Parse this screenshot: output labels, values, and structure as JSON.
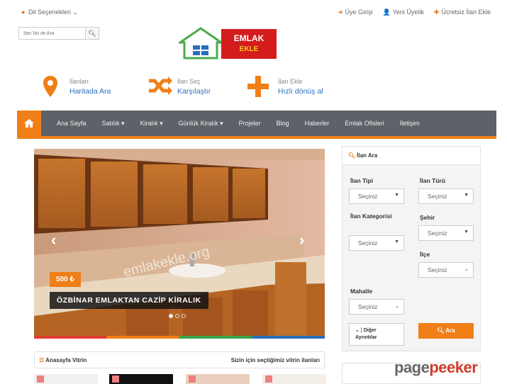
{
  "topbar": {
    "language_label": "Dil Seçenekleri",
    "login_label": "Üye Girişi",
    "register_label": "Yeni Üyelik",
    "free_listing_label": "Ücretsiz İlan Ekle"
  },
  "search": {
    "placeholder": "İlan No ile Ara",
    "button_icon": "search-icon"
  },
  "logo": {
    "line1": "EMLAK",
    "line2": "EKLE"
  },
  "features": [
    {
      "icon": "map-pin-icon",
      "line1": "İlanları",
      "line2": "Haritada Ara"
    },
    {
      "icon": "shuffle-icon",
      "line1": "İlan Seç",
      "line2": "Karşılaştır"
    },
    {
      "icon": "plus-icon",
      "line1": "İlan Ekle",
      "line2": "Hızlı dönüş al"
    }
  ],
  "nav": {
    "items": [
      "Ana Sayfa",
      "Satılık ▾",
      "Kiralık ▾",
      "Günlük Kiralık ▾",
      "Projeler",
      "Blog",
      "Haberler",
      "Emlak Ofisleri",
      "İletişim"
    ]
  },
  "slider": {
    "price": "500 ₺",
    "caption": "ÖZBİNAR EMLAKTAN CAZİP KİRALIK",
    "watermark": "emlakekle.org",
    "prev_icon": "chevron-left-icon",
    "next_icon": "chevron-right-icon"
  },
  "search_panel": {
    "title": "İlan Ara",
    "listing_type_label": "İlan Tipi",
    "listing_type_value": "Seçiniz",
    "listing_kind_label": "İlan Türü",
    "listing_kind_value": "Seçiniz",
    "category_label": "İlan Kategorisi",
    "category_value": "Seçiniz",
    "city_label": "Şehir",
    "city_value": "Seçiniz",
    "district_label": "İlçe",
    "district_value": "Seçiniz",
    "neighborhood_label": "Mahalle",
    "neighborhood_value": "Seçiniz",
    "other_line1": "Diğer",
    "other_line2": "Ayrıntılar",
    "search_button": "Ara"
  },
  "vitrin": {
    "title": "Anasayfa Vitrin",
    "subtitle": "Sizin için seçtiğimiz vitrin ilanları"
  },
  "watermark": {
    "part1": "page",
    "part2": "peeker"
  },
  "colors": {
    "accent": "#f07f18",
    "nav_bg": "#5e6168",
    "link": "#2a6ebb",
    "logo_red": "#d41c1c"
  }
}
